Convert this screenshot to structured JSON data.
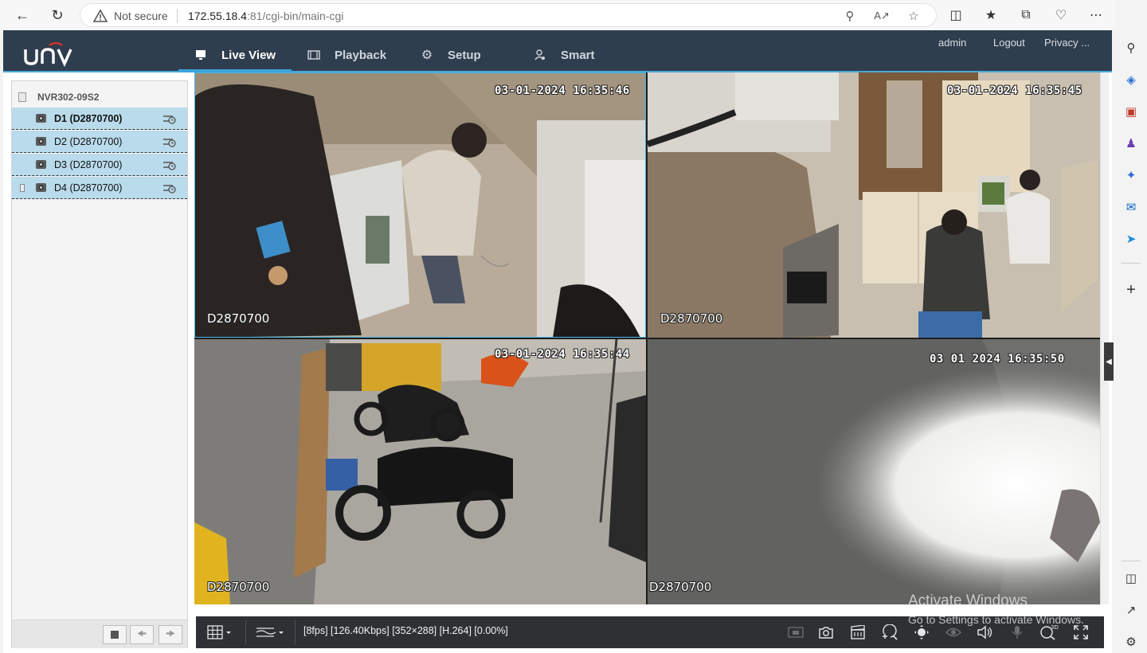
{
  "browser": {
    "security_label": "Not secure",
    "url_host": "172.55.18.4",
    "url_port": ":81",
    "url_path": "/cgi-bin/main-cgi"
  },
  "app": {
    "brand": "UNV",
    "tabs": [
      {
        "label": "Live View",
        "icon": "monitor-icon",
        "active": true
      },
      {
        "label": "Playback",
        "icon": "film-icon",
        "active": false
      },
      {
        "label": "Setup",
        "icon": "gear-icon",
        "active": false
      },
      {
        "label": "Smart",
        "icon": "smart-person-icon",
        "active": false
      }
    ],
    "header_links": {
      "user": "admin",
      "logout": "Logout",
      "privacy": "Privacy ..."
    }
  },
  "device_tree": {
    "nvr_name": "NVR302-09S2",
    "channels": [
      {
        "label": "D1 (D2870700)",
        "selected": true
      },
      {
        "label": "D2 (D2870700)",
        "selected": false
      },
      {
        "label": "D3 (D2870700)",
        "selected": false
      },
      {
        "label": "D4 (D2870700)",
        "selected": false
      }
    ]
  },
  "video": {
    "cells": [
      {
        "timestamp": "03-01-2024 16:35:46",
        "camera": "D2870700"
      },
      {
        "timestamp": "03-01-2024 16:35:45",
        "camera": "D2870700"
      },
      {
        "timestamp": "03-01-2024 16:35:44",
        "camera": "D2870700"
      },
      {
        "timestamp": "03 01 2024 16:35:50",
        "camera": "D2870700"
      }
    ]
  },
  "toolbar": {
    "stream_info": "[8fps] [126.40Kbps] [352×288] [H.264] [0.00%]"
  },
  "watermark": {
    "line1": "Activate Windows",
    "line2": "Go to Settings to activate Windows."
  },
  "colors": {
    "header_bg": "#2f3e4e",
    "accent": "#3aa4dc",
    "channel_bg": "#b9dbeb",
    "toolbar_bg": "#2d3134"
  }
}
